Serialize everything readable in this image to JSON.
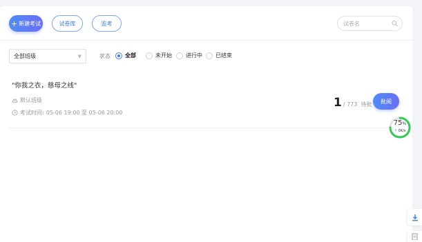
{
  "toolbar": {
    "new_exam_label": "新建考试",
    "new_exam_icon": "plus-icon",
    "question_bank_label": "试卷库",
    "proctor_label": "监考",
    "search_placeholder": "试卷名",
    "search_value": ""
  },
  "filters": {
    "class_selected": "全部班级",
    "status_label": "状态",
    "status_options": [
      {
        "label": "全部",
        "selected": true
      },
      {
        "label": "未开始",
        "selected": false
      },
      {
        "label": "进行中",
        "selected": false
      },
      {
        "label": "已结束",
        "selected": false
      }
    ]
  },
  "exam": {
    "title": "\"你我之衣，慈母之线\"",
    "class_name": "默认班级",
    "time_label": "考试时间:",
    "time_range": "05-06 19:00 至 05-06 20:00",
    "pending_count": "1",
    "total": "/ 773",
    "pending_label": "待批",
    "review_button": "批阅"
  },
  "gauge": {
    "percent_value": 75,
    "percent": "75",
    "percent_unit": "%",
    "speed": "0K/s",
    "color": "#2fcb53"
  },
  "colors": {
    "accent": "#3d7ef5",
    "accent_gradient_end": "#6a6ef5"
  }
}
